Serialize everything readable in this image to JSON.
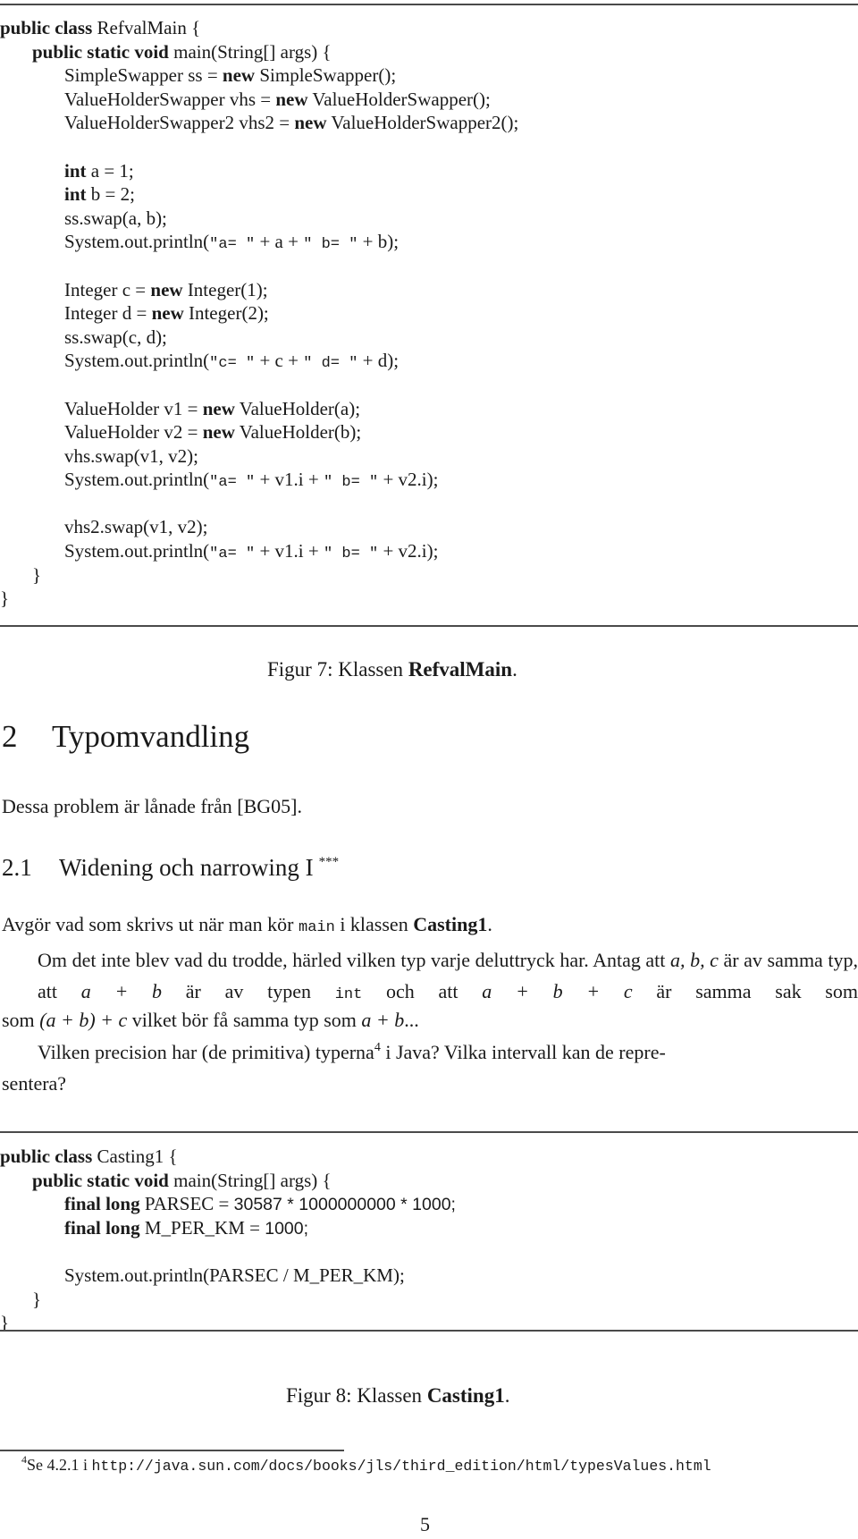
{
  "figure7": {
    "code_lines": [
      {
        "indent": 0,
        "parts": [
          {
            "t": "kw",
            "v": "public class"
          },
          {
            "t": "rm",
            "v": " RefvalMain {"
          }
        ]
      },
      {
        "indent": 1,
        "parts": [
          {
            "t": "kw",
            "v": "public static void"
          },
          {
            "t": "rm",
            "v": " main(String[] args) {"
          }
        ]
      },
      {
        "indent": 2,
        "parts": [
          {
            "t": "rm",
            "v": "SimpleSwapper ss = "
          },
          {
            "t": "kw",
            "v": "new"
          },
          {
            "t": "rm",
            "v": " SimpleSwapper();"
          }
        ]
      },
      {
        "indent": 2,
        "parts": [
          {
            "t": "rm",
            "v": "ValueHolderSwapper vhs = "
          },
          {
            "t": "kw",
            "v": "new"
          },
          {
            "t": "rm",
            "v": " ValueHolderSwapper();"
          }
        ]
      },
      {
        "indent": 2,
        "parts": [
          {
            "t": "rm",
            "v": "ValueHolderSwapper2 vhs2 = "
          },
          {
            "t": "kw",
            "v": "new"
          },
          {
            "t": "rm",
            "v": " ValueHolderSwapper2();"
          }
        ]
      },
      {
        "indent": 0,
        "parts": []
      },
      {
        "indent": 2,
        "parts": [
          {
            "t": "kw",
            "v": "int"
          },
          {
            "t": "rm",
            "v": " a = 1;"
          }
        ]
      },
      {
        "indent": 2,
        "parts": [
          {
            "t": "kw",
            "v": "int"
          },
          {
            "t": "rm",
            "v": " b = 2;"
          }
        ]
      },
      {
        "indent": 2,
        "parts": [
          {
            "t": "rm",
            "v": "ss.swap(a, b);"
          }
        ]
      },
      {
        "indent": 2,
        "parts": [
          {
            "t": "rm",
            "v": "System.out.println("
          },
          {
            "t": "tt",
            "v": "\"a= \""
          },
          {
            "t": "rm",
            "v": " + a + "
          },
          {
            "t": "tt",
            "v": "\" b= \""
          },
          {
            "t": "rm",
            "v": " + b);"
          }
        ]
      },
      {
        "indent": 0,
        "parts": []
      },
      {
        "indent": 2,
        "parts": [
          {
            "t": "rm",
            "v": "Integer c = "
          },
          {
            "t": "kw",
            "v": "new"
          },
          {
            "t": "rm",
            "v": " Integer(1);"
          }
        ]
      },
      {
        "indent": 2,
        "parts": [
          {
            "t": "rm",
            "v": "Integer d = "
          },
          {
            "t": "kw",
            "v": "new"
          },
          {
            "t": "rm",
            "v": " Integer(2);"
          }
        ]
      },
      {
        "indent": 2,
        "parts": [
          {
            "t": "rm",
            "v": "ss.swap(c, d);"
          }
        ]
      },
      {
        "indent": 2,
        "parts": [
          {
            "t": "rm",
            "v": "System.out.println("
          },
          {
            "t": "tt",
            "v": "\"c= \""
          },
          {
            "t": "rm",
            "v": " + c + "
          },
          {
            "t": "tt",
            "v": "\" d= \""
          },
          {
            "t": "rm",
            "v": " + d);"
          }
        ]
      },
      {
        "indent": 0,
        "parts": []
      },
      {
        "indent": 2,
        "parts": [
          {
            "t": "rm",
            "v": "ValueHolder v1 = "
          },
          {
            "t": "kw",
            "v": "new"
          },
          {
            "t": "rm",
            "v": " ValueHolder(a);"
          }
        ]
      },
      {
        "indent": 2,
        "parts": [
          {
            "t": "rm",
            "v": "ValueHolder v2 = "
          },
          {
            "t": "kw",
            "v": "new"
          },
          {
            "t": "rm",
            "v": " ValueHolder(b);"
          }
        ]
      },
      {
        "indent": 2,
        "parts": [
          {
            "t": "rm",
            "v": "vhs.swap(v1, v2);"
          }
        ]
      },
      {
        "indent": 2,
        "parts": [
          {
            "t": "rm",
            "v": "System.out.println("
          },
          {
            "t": "tt",
            "v": "\"a= \""
          },
          {
            "t": "rm",
            "v": " + v1.i + "
          },
          {
            "t": "tt",
            "v": "\" b= \""
          },
          {
            "t": "rm",
            "v": " + v2.i);"
          }
        ]
      },
      {
        "indent": 0,
        "parts": []
      },
      {
        "indent": 2,
        "parts": [
          {
            "t": "rm",
            "v": "vhs2.swap(v1, v2);"
          }
        ]
      },
      {
        "indent": 2,
        "parts": [
          {
            "t": "rm",
            "v": "System.out.println("
          },
          {
            "t": "tt",
            "v": "\"a= \""
          },
          {
            "t": "rm",
            "v": " + v1.i + "
          },
          {
            "t": "tt",
            "v": "\" b= \""
          },
          {
            "t": "rm",
            "v": " + v2.i);"
          }
        ]
      },
      {
        "indent": 1,
        "parts": [
          {
            "t": "rm",
            "v": "}"
          }
        ]
      },
      {
        "indent": 0,
        "parts": [
          {
            "t": "rm",
            "v": "}"
          }
        ]
      }
    ],
    "caption_prefix": "Figur 7: Klassen ",
    "caption_name": "RefvalMain",
    "caption_suffix": "."
  },
  "section": {
    "number": "2",
    "title": "Typomvandling",
    "intro": "Dessa problem är lånade från [BG05]."
  },
  "subsection": {
    "number": "2.1",
    "title": "Widening och narrowing I",
    "difficulty": "***"
  },
  "body": {
    "p1_a": "Avgör vad som skrivs ut när man kör ",
    "p1_code": "main",
    "p1_b": " i klassen ",
    "p1_class": "Casting1",
    "p1_c": ".",
    "p2_a": "Om det inte blev vad du trodde, härled vilken typ varje deluttryck har. Antag att ",
    "p2_m1": "a, b, c",
    "p2_b": " är av samma typ, att ",
    "p2_m2": "a + b",
    "p2_c": " är av typen ",
    "p2_code": "int",
    "p2_d": " och att ",
    "p2_m3": "a + b + c",
    "p2_e": " är samma sak som ",
    "p2_m4": "(a + b) + c",
    "p2_f": " vilket bör få samma typ som ",
    "p2_m5": "a + b",
    "p2_g": "...",
    "p3_a": "Vilken precision har (de primitiva) typerna",
    "p3_fn": "4",
    "p3_b": " i Java? Vilka intervall kan de repre-",
    "p3_c": "sentera?"
  },
  "figure8": {
    "code_lines": [
      {
        "indent": 0,
        "parts": [
          {
            "t": "kw",
            "v": "public class"
          },
          {
            "t": "rm",
            "v": " Casting1 {"
          }
        ]
      },
      {
        "indent": 1,
        "parts": [
          {
            "t": "kw",
            "v": "public static void"
          },
          {
            "t": "rm",
            "v": " main(String[] args) {"
          }
        ]
      },
      {
        "indent": 2,
        "parts": [
          {
            "t": "kw",
            "v": "final long"
          },
          {
            "t": "rm",
            "v": " PARSEC = "
          },
          {
            "t": "sf",
            "v": "30587 * 1000000000 * 1000;"
          }
        ]
      },
      {
        "indent": 2,
        "parts": [
          {
            "t": "kw",
            "v": "final long"
          },
          {
            "t": "rm",
            "v": " M_PER_KM = "
          },
          {
            "t": "sf",
            "v": "1000;"
          }
        ]
      },
      {
        "indent": 0,
        "parts": []
      },
      {
        "indent": 2,
        "parts": [
          {
            "t": "rm",
            "v": "System.out.println(PARSEC / M_PER_KM);"
          }
        ]
      },
      {
        "indent": 1,
        "parts": [
          {
            "t": "rm",
            "v": "}"
          }
        ]
      },
      {
        "indent": 0,
        "parts": [
          {
            "t": "rm",
            "v": "}"
          }
        ]
      }
    ],
    "caption_prefix": "Figur 8: Klassen ",
    "caption_name": "Casting1",
    "caption_suffix": "."
  },
  "footnote": {
    "mark": "4",
    "text": "Se 4.2.1 i ",
    "url": "http://java.sun.com/docs/books/jls/third_edition/html/typesValues.html"
  },
  "page_number": "5"
}
